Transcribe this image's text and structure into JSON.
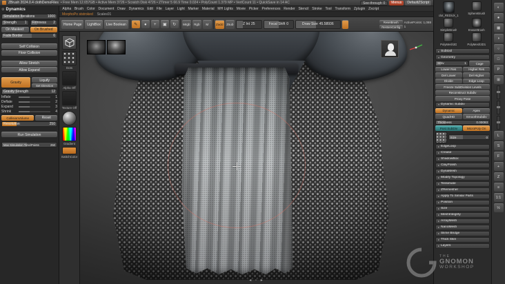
{
  "glyphs": {
    "collapsed": "▸",
    "expanded": "▾",
    "gear": "⚙",
    "nav": "◂ ▫ ▸",
    "mrgb_dot": "●"
  },
  "colors": {
    "accent_orange": "#c87a2e",
    "active_red": "#b5402a",
    "teal": "#2f8a8a",
    "axis_x": "#d94040",
    "axis_y": "#43b943",
    "axis_z": "#4c6fe0"
  },
  "title_bar": {
    "app_title": "ZBrush 2024.0.4 clothDemoFiles",
    "stats": "• Free Mem 12.657GB • Active Mem 3726 • Scratch Disk 4726 • ZTimer 5 66.9 Time 0.024 • PolyCount 1.379 MP • VertCount 11 • QuickSave in 14 AC",
    "see_through_label": "See-through",
    "see_through_value": "0",
    "menus_button": "Menus",
    "zscript_button": "DefaultZScript"
  },
  "menu_bar": [
    "Alpha",
    "Brush",
    "Color",
    "Document",
    "Draw",
    "Dynamics",
    "Edit",
    "File",
    "Layer",
    "Light",
    "Marker",
    "Material",
    "MH Lights",
    "Movie",
    "Picker",
    "Preferences",
    "Render",
    "Stencil",
    "Stroke",
    "Tool",
    "Transform",
    "Zplugin",
    "Zscript"
  ],
  "context_row": {
    "tool_info": "MorphoPo ststroked",
    "alpha_name": "Scales01"
  },
  "shelf": {
    "home_page": "Home Page",
    "lightbox": "LightBox",
    "live_boolean": "Live Boolean",
    "mode_icons": [
      {
        "glyph": "✎"
      },
      {
        "glyph": "●"
      },
      {
        "glyph": "+"
      },
      {
        "glyph": "▣"
      },
      {
        "glyph": "↻"
      }
    ],
    "mrgb": "Mrgb",
    "rgb": "Rgb",
    "m": "M",
    "zadd": "Zadd",
    "zsub": "Zsub",
    "z_intensity_label": "Z Int",
    "z_intensity_value": "25",
    "focal_shift_label": "Focal Shift",
    "focal_shift_value": "0",
    "draw_size_label": "Draw Size",
    "draw_size_value": "45.58936",
    "reset_brush": "ResetBrush",
    "restore_config": "RestoreConfig",
    "active_points": "ActivePoints: 1,088",
    "adjust_value": "1"
  },
  "dynamics_panel": {
    "title": "Dynamics",
    "simulation_iterations_label": "Simulation Iterations",
    "simulation_iterations_value": "1000",
    "strength_label": "Strength",
    "strength_value": "1",
    "firmness_label": "Firmness",
    "firmness_value": "2",
    "on_masked": "On Masked:",
    "on_brushed": "On Brushed",
    "fade_border_label": "Fade Border",
    "fade_border_value": "6",
    "self_collision": "Self Collision",
    "floor_collision": "Floor Collision",
    "allow_stretch": "Allow Stretch",
    "allow_expand": "Allow Expand",
    "gravity": "Gravity",
    "liquify": "Liquify",
    "set_direction": "Set Direction",
    "gravity_strength_label": "Gravity Strength",
    "gravity_strength_value": "12",
    "micro_sliders": [
      {
        "label": "Inflate",
        "value": "1"
      },
      {
        "label": "Deflate",
        "value": "2"
      },
      {
        "label": "Expand",
        "value": "3"
      },
      {
        "label": "Shrink",
        "value": "4"
      }
    ],
    "collision_volume": "CollisionVolume",
    "reset": "Reset",
    "resolution_label": "Resolution",
    "resolution_value": "250",
    "run_simulation": "Run Simulation",
    "max_sim_label": "Max Simulation Time/Points",
    "max_sim_value": "250"
  },
  "left_shelf": {
    "stroke_label": "Dots",
    "alpha_label": "Alpha Off",
    "texture_label": "Texture Off",
    "gradient_label": "Gradient",
    "switch_label": "SwitchColor"
  },
  "canvas": {
    "nav": "◂ ▫ ▸"
  },
  "tool_palette": {
    "tools": [
      {
        "label": "clot_REDUX_1"
      },
      {
        "label": "SphereBrush"
      },
      {
        "label": "SimpleBrush"
      },
      {
        "label": "EraserBrush"
      },
      {
        "label": "PolyMesh3D"
      },
      {
        "label": "PolyMesh3D1"
      }
    ],
    "subtool_header": "Subtool",
    "geometry_header": "Geometry",
    "sdiv_label": "SDiv",
    "sdiv_value": "1",
    "cage": "Cage",
    "lower_res": "Lower Res",
    "higher_res": "Higher Res",
    "del_lower": "Del Lower",
    "del_higher": "Del Higher",
    "divide": "Divide",
    "edge_loop_btn": "Edge Loop",
    "freeze_subdivision": "Freeze SubDivision Levels",
    "reconstruct_subdiv": "Reconstruct Subdiv",
    "proxy_pose": "Proxy Pose",
    "dynamic_subdiv_header": "Dynamic Subdiv",
    "dynamic": "Dynamic",
    "apex": "Apex",
    "quadhd": "QuadHD",
    "smooth_subdiv": "SmoothSubdiv",
    "thickness_label": "Thickness",
    "thickness_value": "0.00093",
    "post_subdiv": "Post SubDiv",
    "micropoly_on": "MicroPoly On",
    "size_label": "Size",
    "size_value": "0",
    "sections": [
      "EdgeLoop",
      "Crease",
      "ShadowBox",
      "ClayPolish",
      "DynaMesh",
      "Modify Topology",
      "Tessimate",
      "ZRemesher",
      "Apply To Similar Parts",
      "Position",
      "Size",
      "MeshIntegrity"
    ],
    "bottom_sections": [
      "ArrayMesh",
      "NanoMesh",
      "Slime Bridge",
      "Thick Skin",
      "Layers"
    ]
  },
  "right_shelf": {
    "icons": [
      {
        "name": "bpr-render-icon",
        "glyph": "◐"
      },
      {
        "name": "render-icon",
        "glyph": "●"
      },
      {
        "name": "polyframe-icon",
        "glyph": "▦"
      },
      {
        "name": "transparency-icon",
        "glyph": "◑"
      },
      {
        "name": "ghost-icon",
        "glyph": "○"
      },
      {
        "name": "solo-icon",
        "glyph": "□"
      },
      {
        "name": "perspective-icon",
        "glyph": "P"
      },
      {
        "name": "floor-grid-icon",
        "glyph": "⊞"
      },
      {
        "name": "local-symmetry-icon",
        "glyph": "L"
      },
      {
        "name": "symmetry-icon",
        "glyph": "S"
      },
      {
        "name": "frame-mesh-icon",
        "glyph": "F"
      },
      {
        "name": "move-canvas-icon",
        "glyph": "+"
      },
      {
        "name": "zoom-canvas-icon",
        "glyph": "Z"
      },
      {
        "name": "scroll-canvas-icon",
        "glyph": "≡"
      },
      {
        "name": "actual-size-icon",
        "glyph": "1:1"
      },
      {
        "name": "aa-half-icon",
        "glyph": "½"
      }
    ]
  },
  "watermark": {
    "line1": "THE",
    "line2": "GNOMON",
    "line3": "WORKSHOP"
  }
}
